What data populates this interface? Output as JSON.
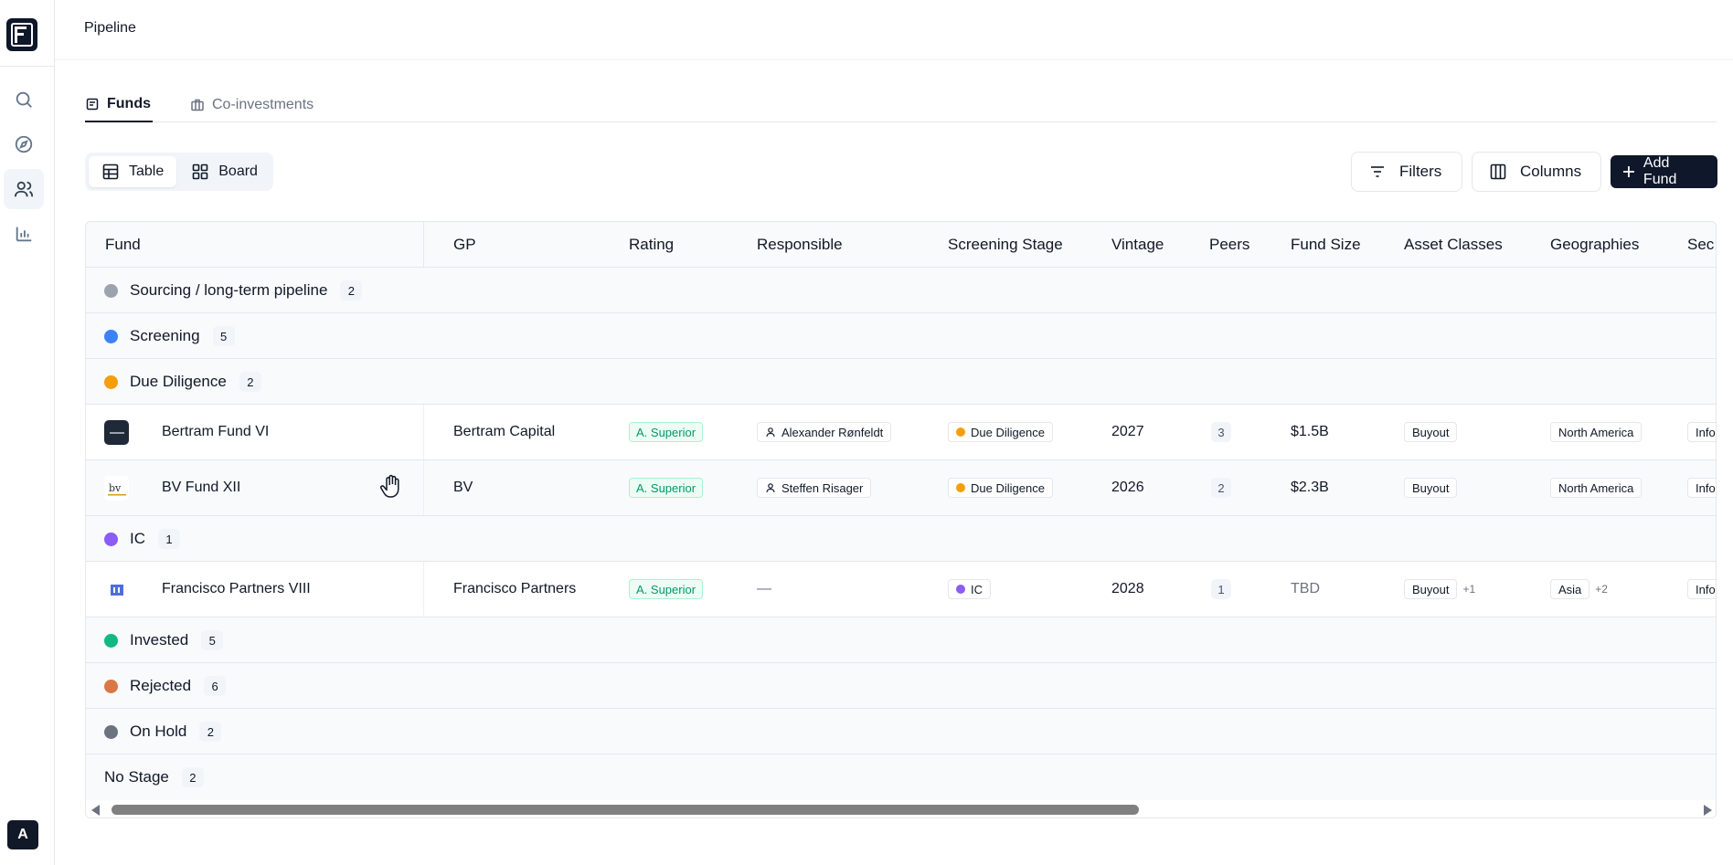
{
  "app": {
    "avatar_initial": "A"
  },
  "sidebar": {
    "items": [
      {
        "icon": "search-icon"
      },
      {
        "icon": "compass-icon"
      },
      {
        "icon": "users-icon",
        "active": true
      },
      {
        "icon": "bar-chart-icon"
      }
    ]
  },
  "header": {
    "title": "Pipeline"
  },
  "tabs": [
    {
      "label": "Funds",
      "active": true
    },
    {
      "label": "Co-investments",
      "active": false
    }
  ],
  "view_toggle": {
    "table_label": "Table",
    "board_label": "Board",
    "selected": "Table"
  },
  "actions": {
    "filters_label": "Filters",
    "columns_label": "Columns",
    "add_fund_label": "Add Fund"
  },
  "table": {
    "columns": [
      "Fund",
      "GP",
      "Rating",
      "Responsible",
      "Screening Stage",
      "Vintage",
      "Peers",
      "Fund Size",
      "Asset Classes",
      "Geographies",
      "Sec"
    ],
    "groups": [
      {
        "label": "Sourcing / long-term pipeline",
        "count": "2",
        "color": "#9ca3af",
        "rows": []
      },
      {
        "label": "Screening",
        "count": "5",
        "color": "#3b82f6",
        "rows": []
      },
      {
        "label": "Due Diligence",
        "count": "2",
        "color": "#f59e0b",
        "rows": [
          {
            "fund": "Bertram Fund VI",
            "gp": "Bertram Capital",
            "rating": "A. Superior",
            "responsible": "Alexander Rønfeldt",
            "stage": "Due Diligence",
            "vintage": "2027",
            "peers": "3",
            "size": "$1.5B",
            "asset": "Buyout",
            "asset_more": "",
            "geo": "North America",
            "geo_more": "",
            "sec": "Info"
          },
          {
            "fund": "BV Fund XII",
            "gp": "BV",
            "rating": "A. Superior",
            "responsible": "Steffen Risager",
            "stage": "Due Diligence",
            "vintage": "2026",
            "peers": "2",
            "size": "$2.3B",
            "asset": "Buyout",
            "asset_more": "",
            "geo": "North America",
            "geo_more": "",
            "sec": "Info"
          }
        ]
      },
      {
        "label": "IC",
        "count": "1",
        "color": "#8b5cf6",
        "rows": [
          {
            "fund": "Francisco Partners VIII",
            "gp": "Francisco Partners",
            "rating": "A. Superior",
            "responsible": "—",
            "stage": "IC",
            "vintage": "2028",
            "peers": "1",
            "size": "TBD",
            "asset": "Buyout",
            "asset_more": "+1",
            "geo": "Asia",
            "geo_more": "+2",
            "sec": "Info"
          }
        ]
      },
      {
        "label": "Invested",
        "count": "5",
        "color": "#10b981",
        "rows": []
      },
      {
        "label": "Rejected",
        "count": "6",
        "color": "#d97745",
        "rows": []
      },
      {
        "label": "On Hold",
        "count": "2",
        "color": "#6b7280",
        "rows": []
      },
      {
        "label": "No Stage",
        "count": "2",
        "color": "",
        "rows": []
      }
    ]
  }
}
